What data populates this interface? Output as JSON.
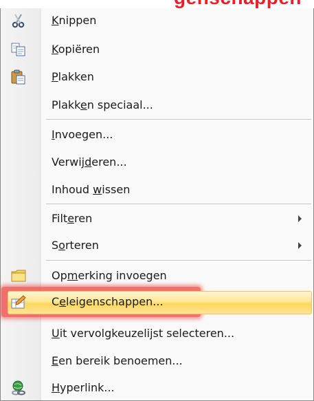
{
  "banner": {
    "text": "genschappen"
  },
  "menu": {
    "items": [
      {
        "id": "knippen",
        "pre": "",
        "ul": "K",
        "post": "nippen",
        "icon": "scissors-icon",
        "submenu": false
      },
      {
        "id": "kopieren",
        "pre": "",
        "ul": "K",
        "post": "opiëren",
        "icon": "copy-icon",
        "submenu": false
      },
      {
        "id": "plakken",
        "pre": "",
        "ul": "P",
        "post": "lakken",
        "icon": "paste-icon",
        "submenu": false
      },
      {
        "id": "plakken-speciaal",
        "pre": "Plakk",
        "ul": "e",
        "post": "n speciaal...",
        "icon": "",
        "submenu": false
      },
      {
        "id": "invoegen",
        "pre": "",
        "ul": "I",
        "post": "nvoegen...",
        "icon": "",
        "submenu": false
      },
      {
        "id": "verwijderen",
        "pre": "Verwij",
        "ul": "d",
        "post": "eren...",
        "icon": "",
        "submenu": false
      },
      {
        "id": "inhoud-wissen",
        "pre": "Inhoud ",
        "ul": "w",
        "post": "issen",
        "icon": "",
        "submenu": false
      },
      {
        "id": "filteren",
        "pre": "Filt",
        "ul": "e",
        "post": "ren",
        "icon": "",
        "submenu": true
      },
      {
        "id": "sorteren",
        "pre": "S",
        "ul": "o",
        "post": "rteren",
        "icon": "",
        "submenu": true
      },
      {
        "id": "opmerking-invoegen",
        "pre": "Op",
        "ul": "m",
        "post": "erking invoegen",
        "icon": "comment-icon",
        "submenu": false
      },
      {
        "id": "celeigenschappen",
        "pre": "C",
        "ul": "e",
        "post": "leigenschappen...",
        "icon": "cell-properties-icon",
        "submenu": false
      },
      {
        "id": "uit-vervolgkeuzelijst",
        "pre": "",
        "ul": "U",
        "post": "it vervolgkeuzelijst selecteren...",
        "icon": "",
        "submenu": false
      },
      {
        "id": "een-bereik-benoemen",
        "pre": "",
        "ul": "E",
        "post": "en bereik benoemen...",
        "icon": "",
        "submenu": false
      },
      {
        "id": "hyperlink",
        "pre": "",
        "ul": "H",
        "post": "yperlink...",
        "icon": "hyperlink-icon",
        "submenu": false
      }
    ],
    "highlighted_item": "celeigenschappen"
  },
  "colors": {
    "highlight": "#ffd75c",
    "annotation": "#ef5350",
    "banner_text": "#e8202a"
  }
}
